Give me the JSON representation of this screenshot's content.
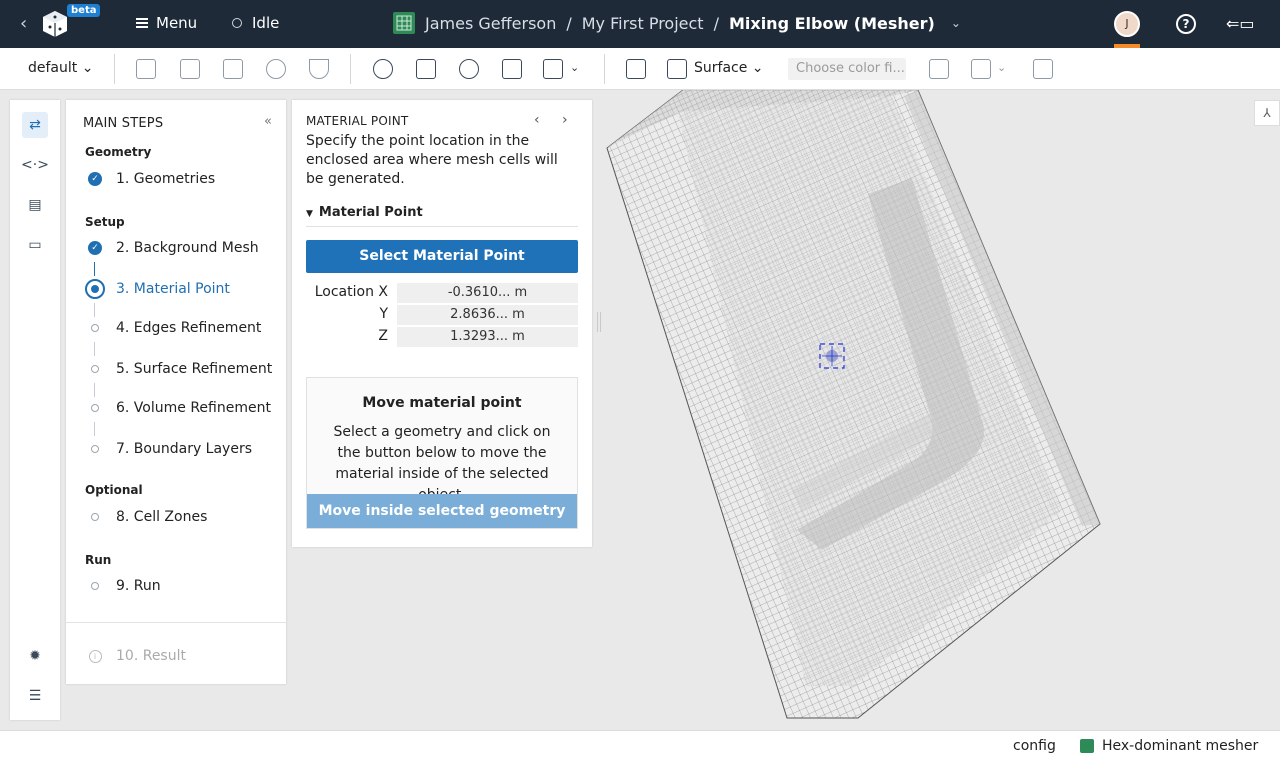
{
  "topbar": {
    "beta": "beta",
    "menu_label": "Menu",
    "status_label": "Idle",
    "breadcrumb": {
      "owner": "James Gefferson",
      "sep1": "/",
      "project": "My First Project",
      "sep2": "/",
      "current": "Mixing Elbow (Mesher)"
    },
    "avatar_initial": "J",
    "help_glyph": "?"
  },
  "toolbar": {
    "view_preset": "default",
    "render_mode": "Surface",
    "color_placeholder": "Choose color fi..."
  },
  "steps": {
    "title": "MAIN STEPS",
    "collapse_glyph": "«",
    "groups": {
      "geometry": "Geometry",
      "setup": "Setup",
      "optional": "Optional",
      "run": "Run"
    },
    "items": [
      {
        "label": "1. Geometries",
        "state": "done"
      },
      {
        "label": "2. Background Mesh",
        "state": "done"
      },
      {
        "label": "3. Material Point",
        "state": "current"
      },
      {
        "label": "4. Edges Refinement",
        "state": "todo"
      },
      {
        "label": "5. Surface Refinement",
        "state": "todo"
      },
      {
        "label": "6. Volume Refinement",
        "state": "todo"
      },
      {
        "label": "7. Boundary Layers",
        "state": "todo"
      },
      {
        "label": "8. Cell Zones",
        "state": "todo"
      },
      {
        "label": "9. Run",
        "state": "todo"
      },
      {
        "label": "10. Result",
        "state": "disabled"
      }
    ]
  },
  "material_point": {
    "title": "MATERIAL POINT",
    "prev_glyph": "‹",
    "next_glyph": "›",
    "description": "Specify the point location in the enclosed area where mesh cells will be generated.",
    "section_label": "Material Point",
    "select_button": "Select Material Point",
    "location": {
      "x_label": "Location X",
      "x_value": "-0.3610... m",
      "y_label": "Y",
      "y_value": "2.8636... m",
      "z_label": "Z",
      "z_value": "1.3293... m"
    },
    "move_box": {
      "title": "Move material point",
      "description": "Select a geometry and click on the button below to move the material inside of the selected object.",
      "button": "Move inside selected geometry"
    }
  },
  "statusbar": {
    "config": "config",
    "mesher": "Hex-dominant mesher"
  },
  "colors": {
    "topbar_bg": "#1e2a38",
    "accent": "#1f72b8",
    "accent_disabled": "#7aaed8",
    "project_green": "#2e8b57",
    "avatar_underline": "#f28c28"
  }
}
